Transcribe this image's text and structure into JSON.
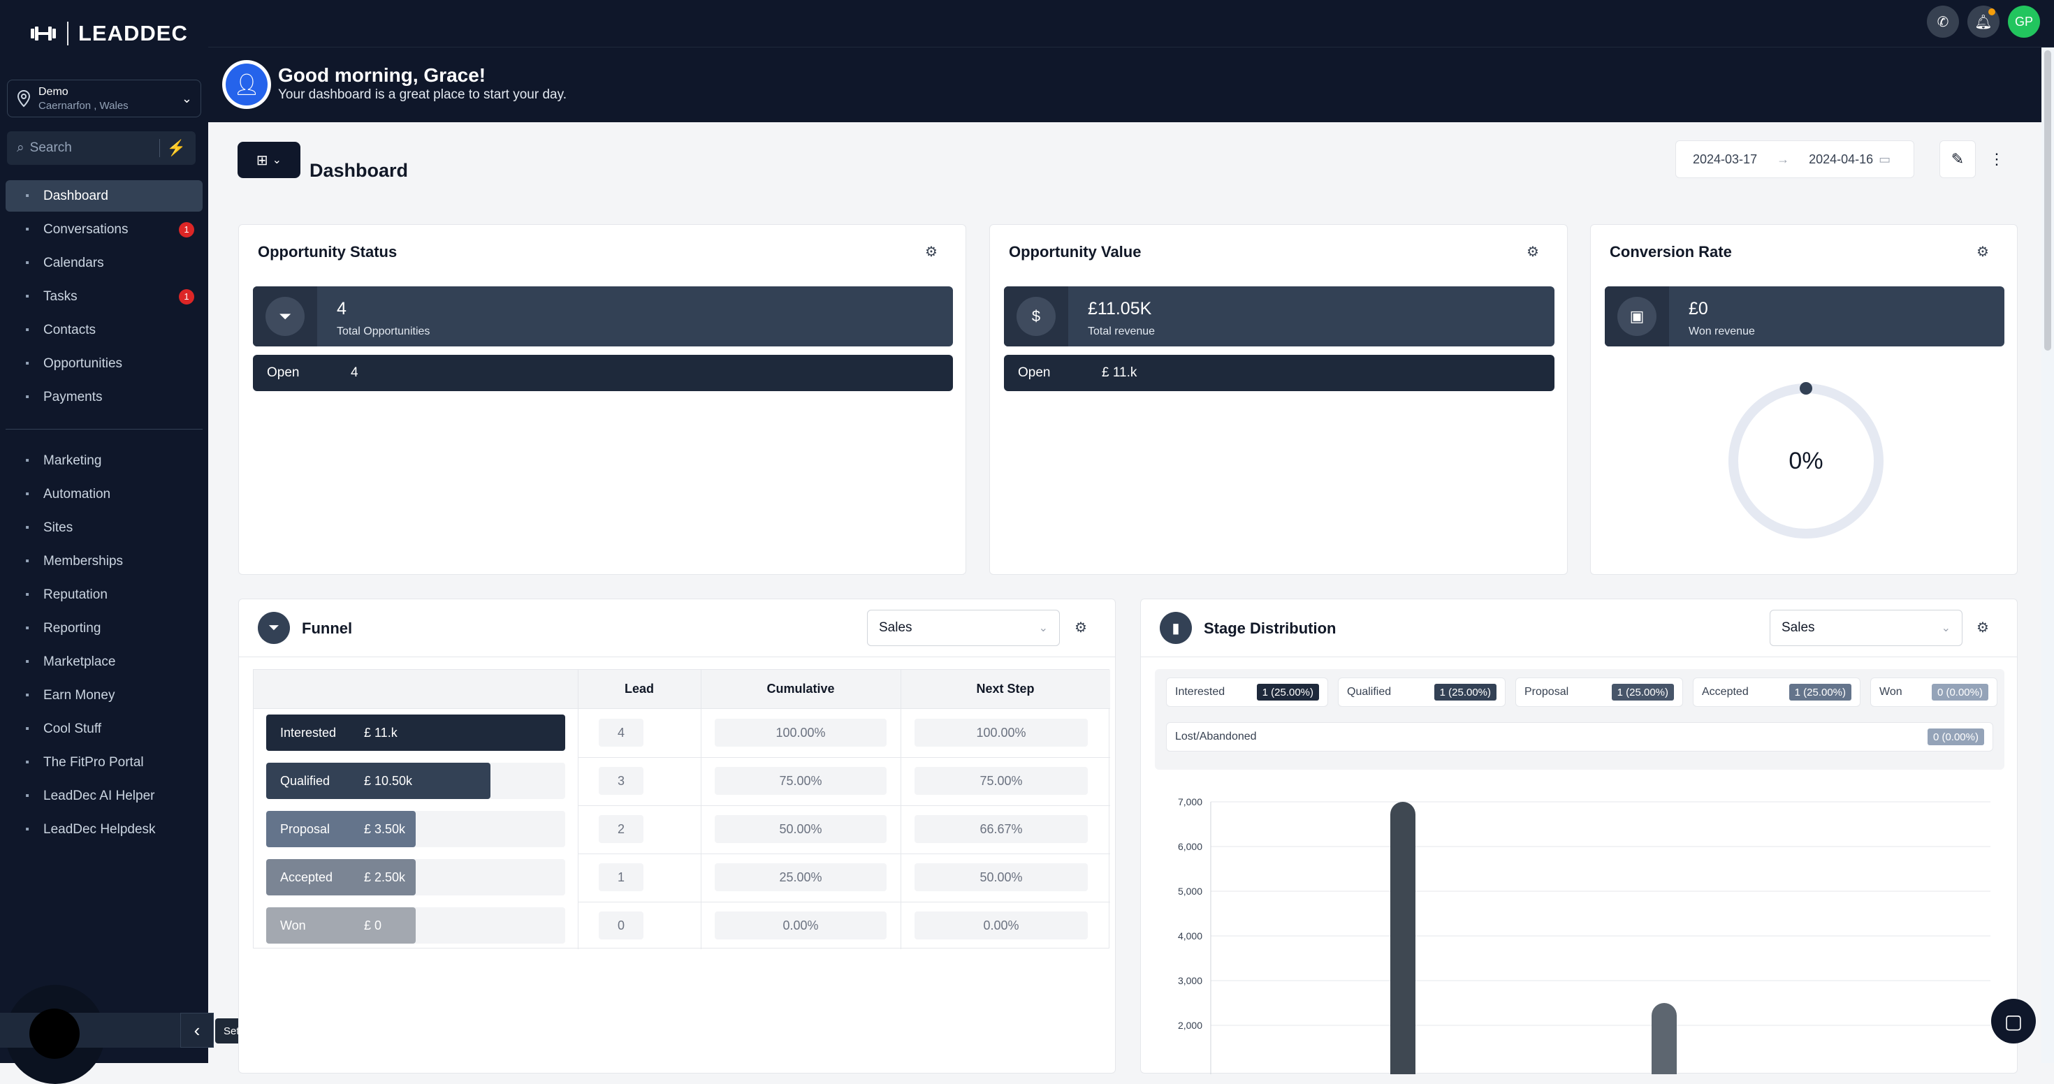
{
  "brand": {
    "name": "LEADDEC"
  },
  "location": {
    "name": "Demo",
    "place": "Caernarfon , Wales"
  },
  "search": {
    "placeholder": "Search"
  },
  "nav_primary": [
    {
      "label": "Dashboard",
      "icon": "dashboard-icon",
      "active": true
    },
    {
      "label": "Conversations",
      "icon": "chat-icon",
      "badge": "1"
    },
    {
      "label": "Calendars",
      "icon": "calendar-icon"
    },
    {
      "label": "Tasks",
      "icon": "checkbox-icon",
      "badge": "1"
    },
    {
      "label": "Contacts",
      "icon": "user-icon"
    },
    {
      "label": "Opportunities",
      "icon": "funnel-icon"
    },
    {
      "label": "Payments",
      "icon": "card-icon"
    }
  ],
  "nav_secondary": [
    {
      "label": "Marketing",
      "icon": "megaphone-icon"
    },
    {
      "label": "Automation",
      "icon": "automation-icon"
    },
    {
      "label": "Sites",
      "icon": "globe-icon"
    },
    {
      "label": "Memberships",
      "icon": "members-icon"
    },
    {
      "label": "Reputation",
      "icon": "star-icon"
    },
    {
      "label": "Reporting",
      "icon": "chart-icon"
    },
    {
      "label": "Marketplace",
      "icon": "cart-icon"
    },
    {
      "label": "Earn Money",
      "icon": "money-icon"
    },
    {
      "label": "Cool Stuff",
      "icon": "flame-icon"
    },
    {
      "label": "The FitPro Portal",
      "icon": "dumbbell-icon"
    },
    {
      "label": "LeadDec AI Helper",
      "icon": "robot-icon"
    },
    {
      "label": "LeadDec Helpdesk",
      "icon": "info-icon"
    }
  ],
  "settings": {
    "label": "Settings",
    "partial_label": "ngs",
    "tooltip": "Settings"
  },
  "topbar": {
    "avatar_initials": "GP"
  },
  "greeting": {
    "title": "Good morning, Grace!",
    "subtitle": "Your dashboard is a great place to start your day."
  },
  "header": {
    "title": "Dashboard",
    "date_from": "2024-03-17",
    "date_to": "2024-04-16"
  },
  "opportunity_status": {
    "title": "Opportunity Status",
    "count": "4",
    "count_label": "Total Opportunities",
    "open_label": "Open",
    "open_value": "4"
  },
  "opportunity_value": {
    "title": "Opportunity Value",
    "value": "£11.05K",
    "value_label": "Total revenue",
    "open_label": "Open",
    "open_value": "£ 11.k"
  },
  "conversion_rate": {
    "title": "Conversion Rate",
    "value": "£0",
    "value_label": "Won revenue",
    "percent": "0%",
    "percent_value": 0
  },
  "funnel": {
    "title": "Funnel",
    "pipeline": "Sales",
    "columns": [
      "Lead",
      "Cumulative",
      "Next Step"
    ],
    "rows": [
      {
        "stage": "Interested",
        "value": "£ 11.k",
        "lead": "4",
        "cumulative": "100.00%",
        "next": "100.00%",
        "fill": 1.0,
        "color": "#1e293b"
      },
      {
        "stage": "Qualified",
        "value": "£ 10.50k",
        "lead": "3",
        "cumulative": "75.00%",
        "next": "75.00%",
        "fill": 0.75,
        "color": "#334155"
      },
      {
        "stage": "Proposal",
        "value": "£ 3.50k",
        "lead": "2",
        "cumulative": "50.00%",
        "next": "66.67%",
        "fill": 0.5,
        "color": "#64748b"
      },
      {
        "stage": "Accepted",
        "value": "£ 2.50k",
        "lead": "1",
        "cumulative": "25.00%",
        "next": "50.00%",
        "fill": 0.5,
        "color": "#7b8594"
      },
      {
        "stage": "Won",
        "value": "£ 0",
        "lead": "0",
        "cumulative": "0.00%",
        "next": "0.00%",
        "fill": 0.5,
        "color": "#a3a8b0"
      }
    ]
  },
  "stage_distribution": {
    "title": "Stage Distribution",
    "pipeline": "Sales",
    "chips": [
      {
        "label": "Interested",
        "value": "1 (25.00%)",
        "color": "#1e293b"
      },
      {
        "label": "Qualified",
        "value": "1 (25.00%)",
        "color": "#334155"
      },
      {
        "label": "Proposal",
        "value": "1 (25.00%)",
        "color": "#475569"
      },
      {
        "label": "Accepted",
        "value": "1 (25.00%)",
        "color": "#64748b"
      },
      {
        "label": "Won",
        "value": "0 (0.00%)",
        "color": "#94a3b8"
      },
      {
        "label": "Lost/Abandoned",
        "value": "0 (0.00%)",
        "color": "#94a3b8"
      }
    ]
  },
  "chart_data": {
    "type": "bar",
    "title": "",
    "yticks": [
      "7,000",
      "6,000",
      "5,000",
      "4,000",
      "3,000",
      "2,000"
    ],
    "ylim": [
      0,
      7000
    ],
    "grid": true,
    "values": [
      7000,
      2500
    ],
    "colors": [
      "#3f4852",
      "#5d6670"
    ]
  }
}
